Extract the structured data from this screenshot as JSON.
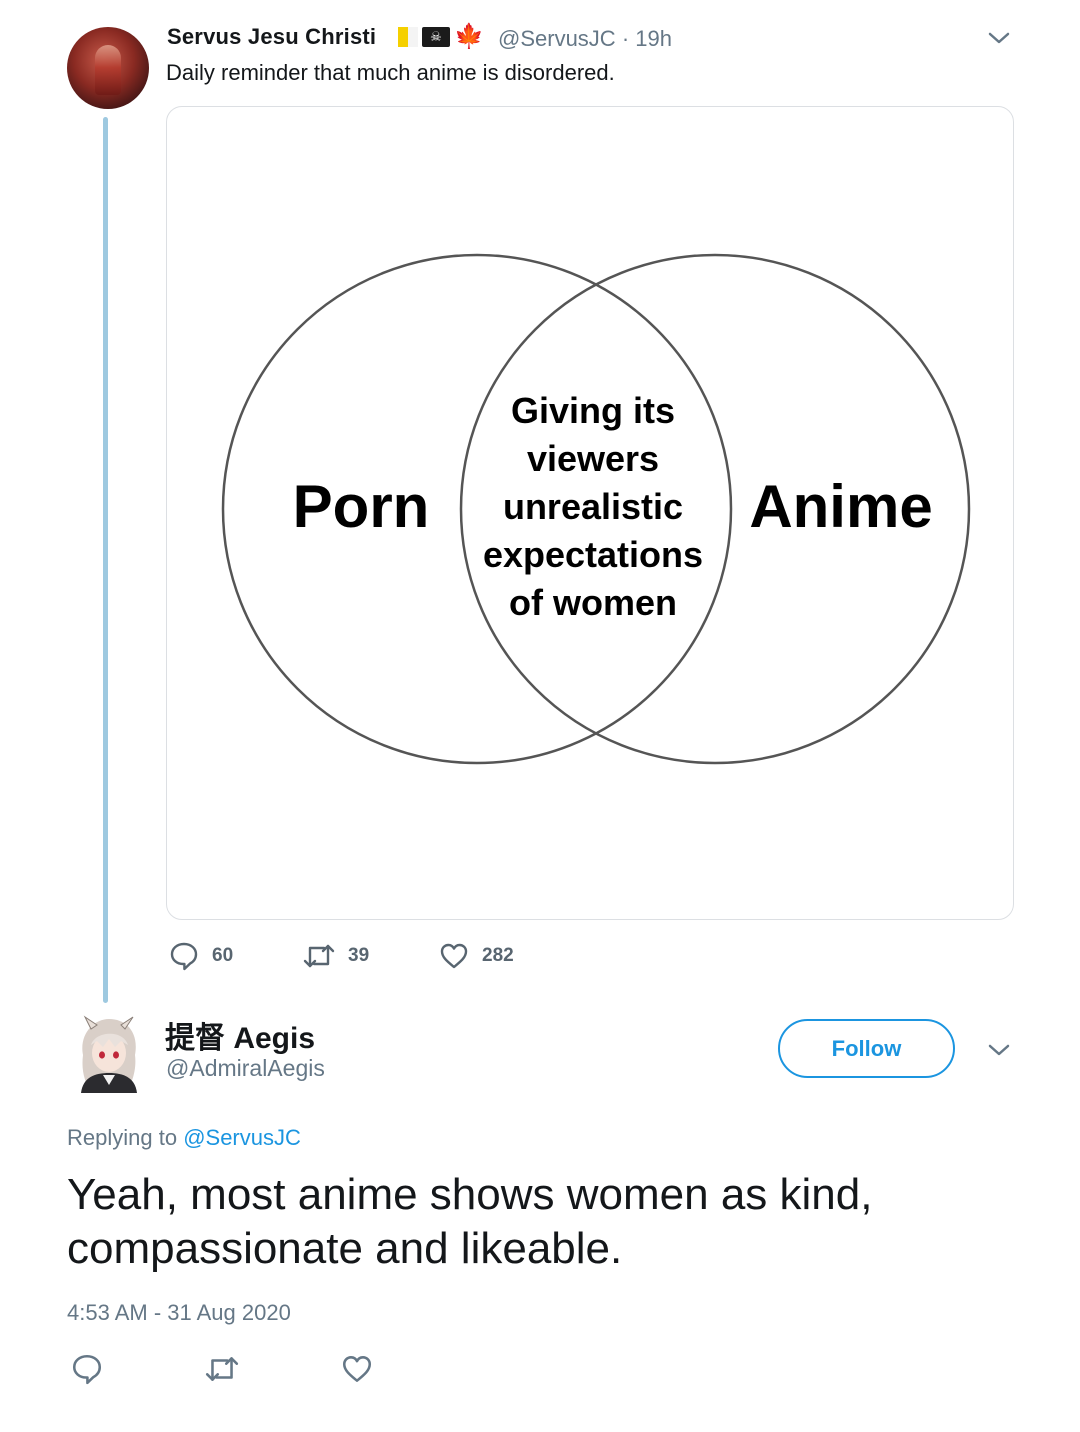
{
  "tweet": {
    "author_name": "Servus Jesu Christi",
    "flags": [
      "vatican-flag",
      "pirate-flag",
      "maple-leaf"
    ],
    "pirate_glyph": "☠",
    "maple_glyph": "🍁",
    "handle": "@ServusJC",
    "time_sep": "·",
    "time_ago": "19h",
    "text": "Daily reminder that much anime is disordered.",
    "venn": {
      "left_label": "Porn",
      "right_label": "Anime",
      "overlap_lines": [
        "Giving its",
        "viewers",
        "unrealistic",
        "expectations",
        "of women"
      ]
    },
    "stats": {
      "replies": "60",
      "retweets": "39",
      "likes": "282"
    },
    "colors": {
      "thread_line": "#9ec9e0"
    }
  },
  "reply": {
    "author_name": "提督 Aegis",
    "handle": "@AdmiralAegis",
    "follow_label": "Follow",
    "replying_prefix": "Replying to ",
    "replying_handle": "@ServusJC",
    "text": "Yeah, most anime shows women as kind, compassionate and likeable.",
    "timestamp": "4:53 AM - 31 Aug 2020",
    "colors": {
      "accent": "#1b95e0",
      "muted": "#657786"
    }
  }
}
